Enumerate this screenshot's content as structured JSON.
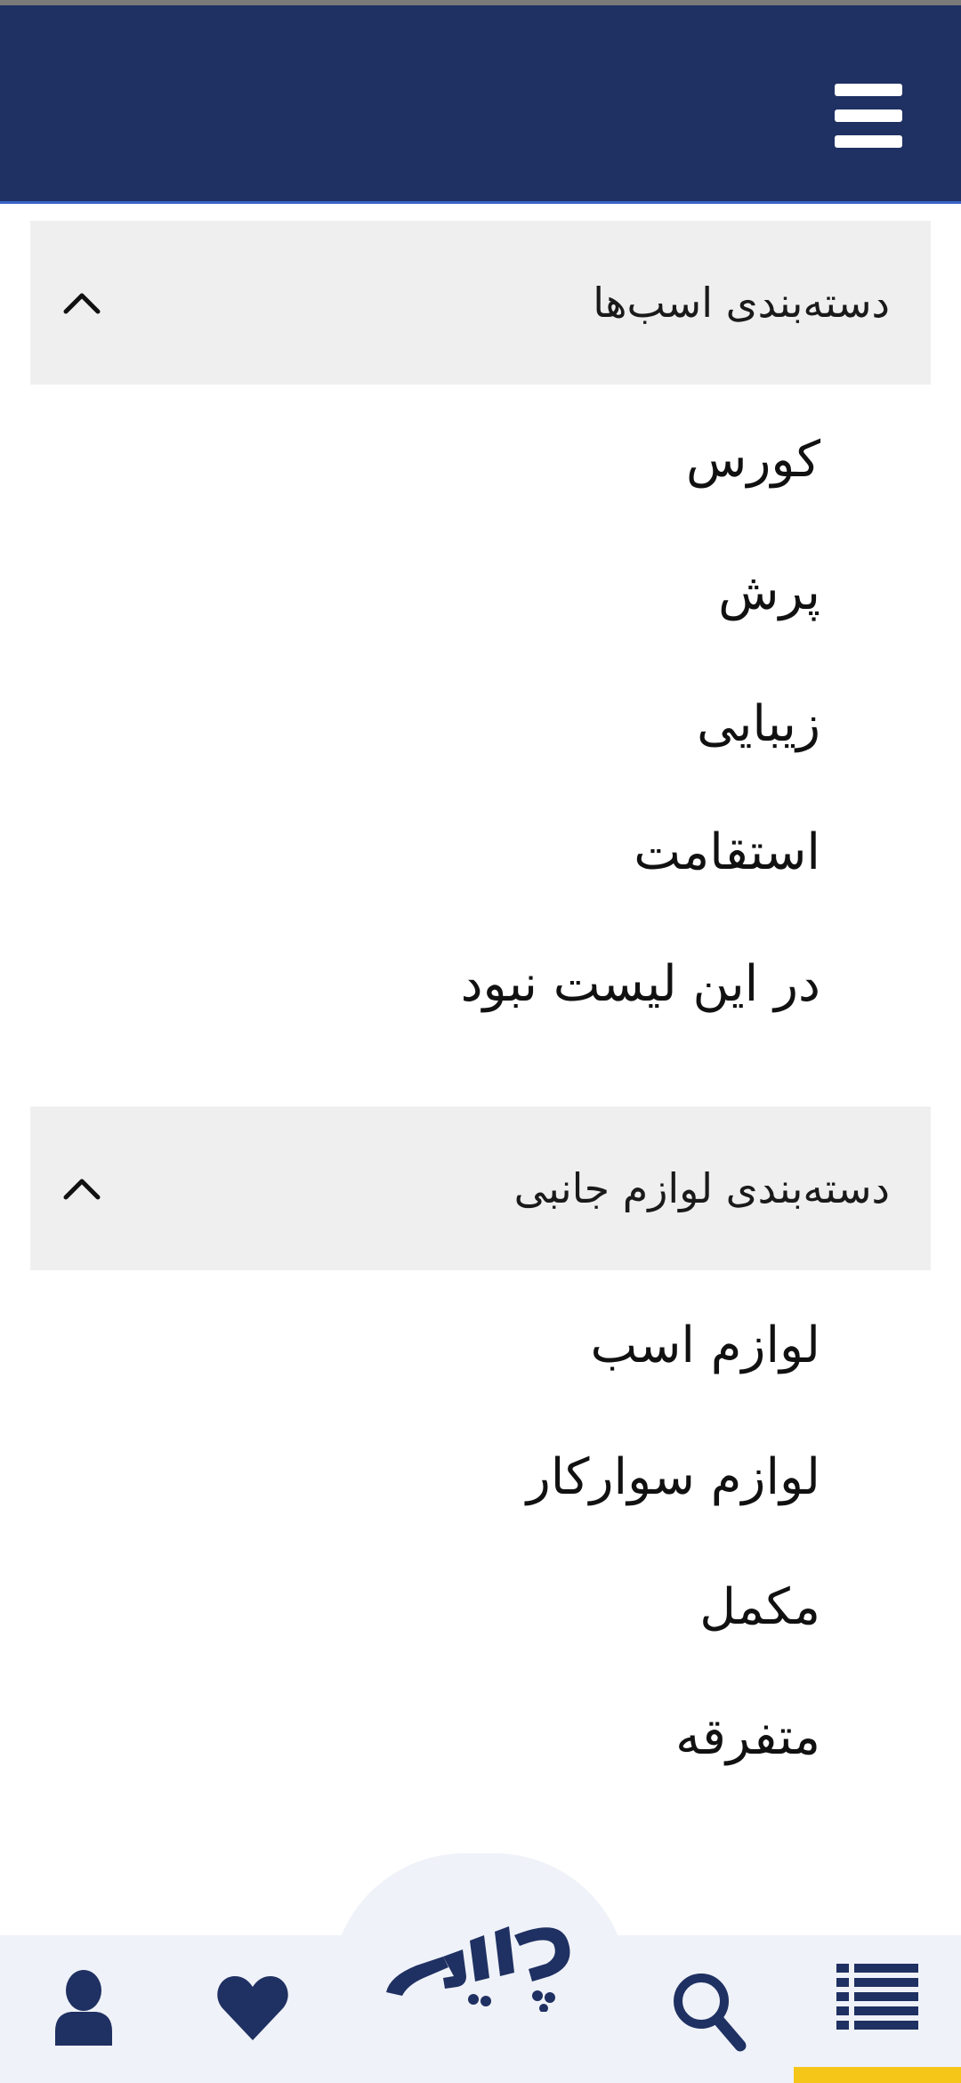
{
  "header": {
    "menu_icon": "hamburger-menu-icon",
    "background": "#1f3062"
  },
  "sections": [
    {
      "title": "دسته‌بندی اسب‌ها",
      "items": [
        "کورس",
        "پرش",
        "زیبایی",
        "استقامت",
        "در این لیست نبود"
      ]
    },
    {
      "title": "دسته‌بندی لوازم جانبی",
      "items": [
        "لوازم اسب",
        "لوازم سوارکار",
        "مکمل",
        "متفرقه"
      ]
    }
  ],
  "bottom_nav": {
    "items": [
      "list-icon",
      "search-icon",
      "chapar-logo",
      "heart-icon",
      "user-icon"
    ],
    "icon_color": "#1f3062",
    "accent": "#f5c518"
  }
}
